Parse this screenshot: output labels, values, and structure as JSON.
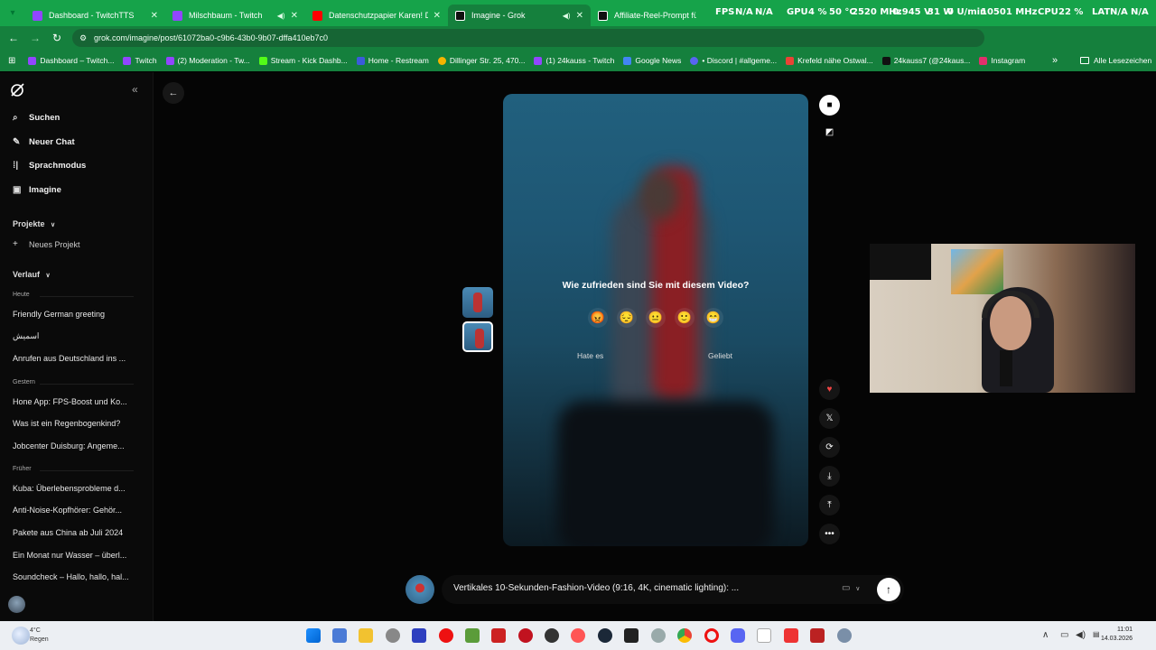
{
  "browser": {
    "tabs": [
      {
        "title": "Dashboard - TwitchTTS",
        "active": false
      },
      {
        "title": "Milschbaum - Twitch",
        "active": false
      },
      {
        "title": "Datenschutzpapier Karen! Dein",
        "active": false
      },
      {
        "title": "Imagine - Grok",
        "active": true
      },
      {
        "title": "Affiliate-Reel-Prompt für Styling",
        "active": false
      }
    ],
    "hud": {
      "fps_label": "FPS",
      "fps_value": "N/A",
      "fps_value2": "N/A",
      "gpu_label": "GPU",
      "gpu_load": "4 %",
      "gpu_temp": "50 °C",
      "gpu_clock": "2520 MHz",
      "gpu_volt": "0.945 V",
      "gpu_power": "31 W",
      "gpu_fan": "0 U/min",
      "gpu_mem": "10501 MHz",
      "cpu_label": "CPU",
      "cpu_load": "22 %",
      "lat_label": "LAT",
      "lat_value": "N/A",
      "lat_value2": "N/A"
    },
    "url": "grok.com/imagine/post/61072ba0-c9b6-43b0-9b07-dffa410eb7c0",
    "bookmarks": [
      "Dashboard – Twitch...",
      "Twitch",
      "(2) Moderation - Tw...",
      "Stream - Kick Dashb...",
      "Home - Restream",
      "Dillinger Str. 25, 470...",
      "(1) 24kauss - Twitch",
      "Google News",
      "• Discord | #allgeme...",
      "Krefeld nähe Ostwal...",
      "24kauss7 (@24kaus...",
      "Instagram"
    ],
    "bookmarks_more": "»",
    "all_bookmarks": "Alle Lesezeichen"
  },
  "sidebar": {
    "nav": [
      {
        "label": "Suchen",
        "icon": "search-icon"
      },
      {
        "label": "Neuer Chat",
        "icon": "edit-icon"
      },
      {
        "label": "Sprachmodus",
        "icon": "voice-icon"
      },
      {
        "label": "Imagine",
        "icon": "image-icon"
      }
    ],
    "projects_label": "Projekte",
    "new_project": "Neues Projekt",
    "history_label": "Verlauf",
    "groups": [
      {
        "label": "Heute",
        "items": [
          "Friendly German greeting",
          "اسمیش",
          "Anrufen aus Deutschland ins ..."
        ]
      },
      {
        "label": "Gestern",
        "items": [
          "Hone App: FPS-Boost und Ko...",
          "Was ist ein Regenbogenkind?",
          "Jobcenter Duisburg: Angeme..."
        ]
      },
      {
        "label": "Früher",
        "items": [
          "Kuba: Überlebensprobleme d...",
          "Anti-Noise-Kopfhörer: Gehör...",
          "Pakete aus China ab Juli 2024",
          "Ein Monat nur Wasser – überl...",
          "Soundcheck – Hallo, hallo, hal..."
        ]
      }
    ]
  },
  "rating": {
    "question": "Wie zufrieden sind Sie mit diesem Video?",
    "emojis": [
      "😡",
      "😔",
      "😐",
      "🙂",
      "😁"
    ],
    "low_label": "Hate es",
    "high_label": "Geliebt"
  },
  "prompt": {
    "text": "Vertikales 10-Sekunden-Fashion-Video (9:16, 4K, cinematic lighting): ...",
    "mode_icon": "video-mode-icon"
  },
  "taskbar": {
    "weather_temp": "4°C",
    "weather_cond": "Regen",
    "time": "11:01",
    "date": "14.03.2026"
  }
}
